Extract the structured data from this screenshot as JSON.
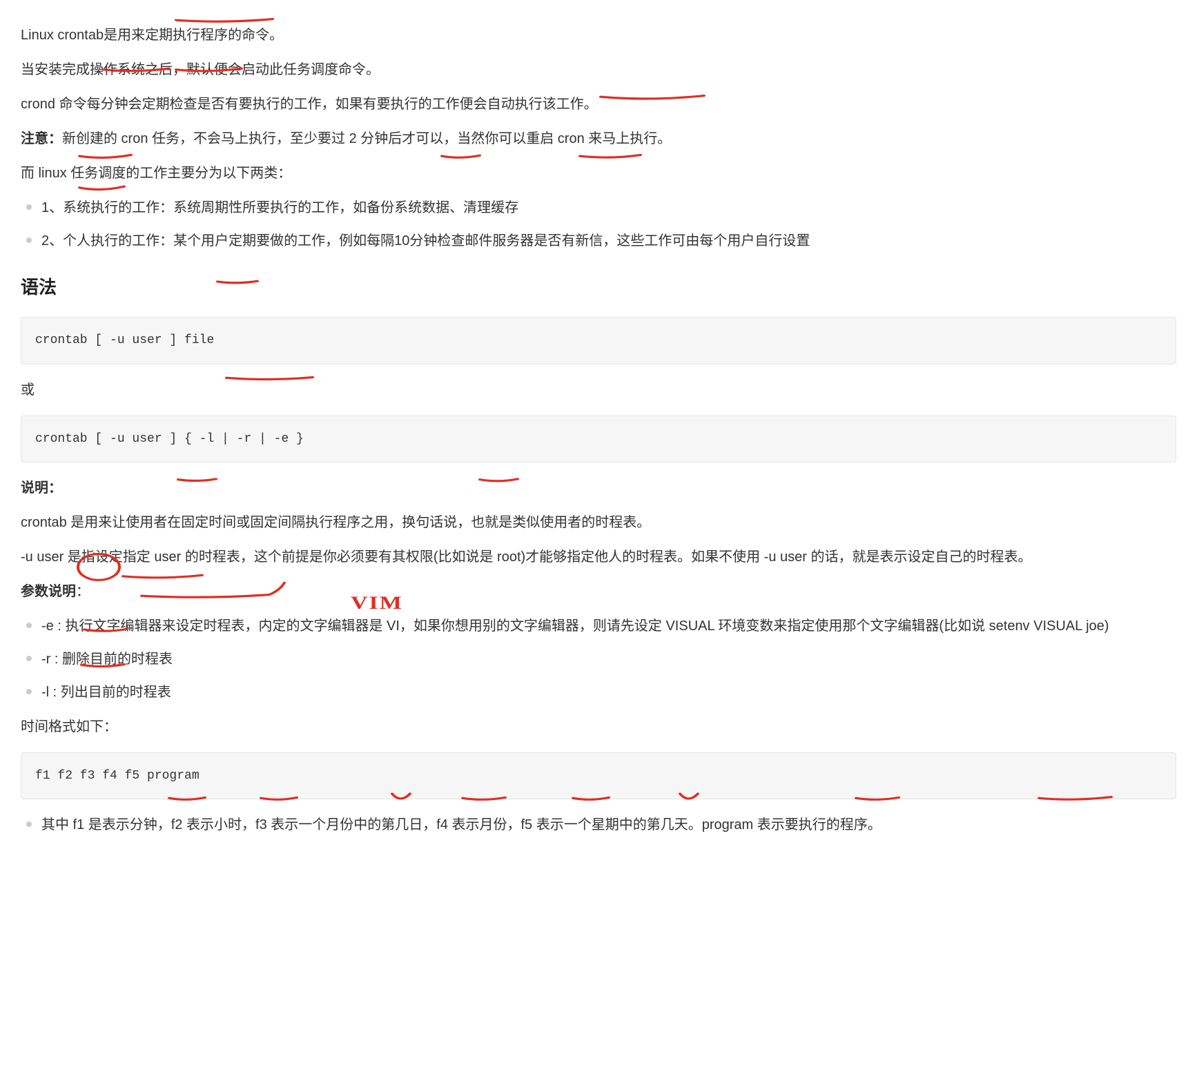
{
  "paragraphs": {
    "p1": "Linux crontab是用来定期执行程序的命令。",
    "p2": "当安装完成操作系统之后，默认便会启动此任务调度命令。",
    "p3": "crond 命令每分钟会定期检查是否有要执行的工作，如果有要执行的工作便会自动执行该工作。",
    "p4_strong": "注意：",
    "p4_rest": "新创建的 cron 任务，不会马上执行，至少要过 2 分钟后才可以，当然你可以重启 cron 来马上执行。",
    "p5": "而 linux 任务调度的工作主要分为以下两类：",
    "list1_item1": "1、系统执行的工作：系统周期性所要执行的工作，如备份系统数据、清理缓存",
    "list1_item2": "2、个人执行的工作：某个用户定期要做的工作，例如每隔10分钟检查邮件服务器是否有新信，这些工作可由每个用户自行设置",
    "h2_syntax": "语法",
    "code1": "crontab [ -u user ] file",
    "or": "或",
    "code2": "crontab [ -u user ] { -l | -r | -e }",
    "p6": "说明：",
    "p7": "crontab 是用来让使用者在固定时间或固定间隔执行程序之用，换句话说，也就是类似使用者的时程表。",
    "p8": "-u user 是指设定指定 user 的时程表，这个前提是你必须要有其权限(比如说是 root)才能够指定他人的时程表。如果不使用 -u user 的话，就是表示设定自己的时程表。",
    "p9_strong": "参数说明",
    "p9_colon": "：",
    "params_e": "-e : 执行文字编辑器来设定时程表，内定的文字编辑器是 VI，如果你想用别的文字编辑器，则请先设定 VISUAL 环境变数来指定使用那个文字编辑器(比如说 setenv VISUAL joe)",
    "params_r": "-r : 删除目前的时程表",
    "params_l": "-l : 列出目前的时程表",
    "p10": "时间格式如下：",
    "code3": "f1 f2 f3 f4 f5 program",
    "format_item1": "其中 f1 是表示分钟，f2 表示小时，f3 表示一个月份中的第几日，f4 表示月份，f5 表示一个星期中的第几天。program 表示要执行的程序。"
  },
  "annotations": {
    "vim_label": "VIM"
  }
}
